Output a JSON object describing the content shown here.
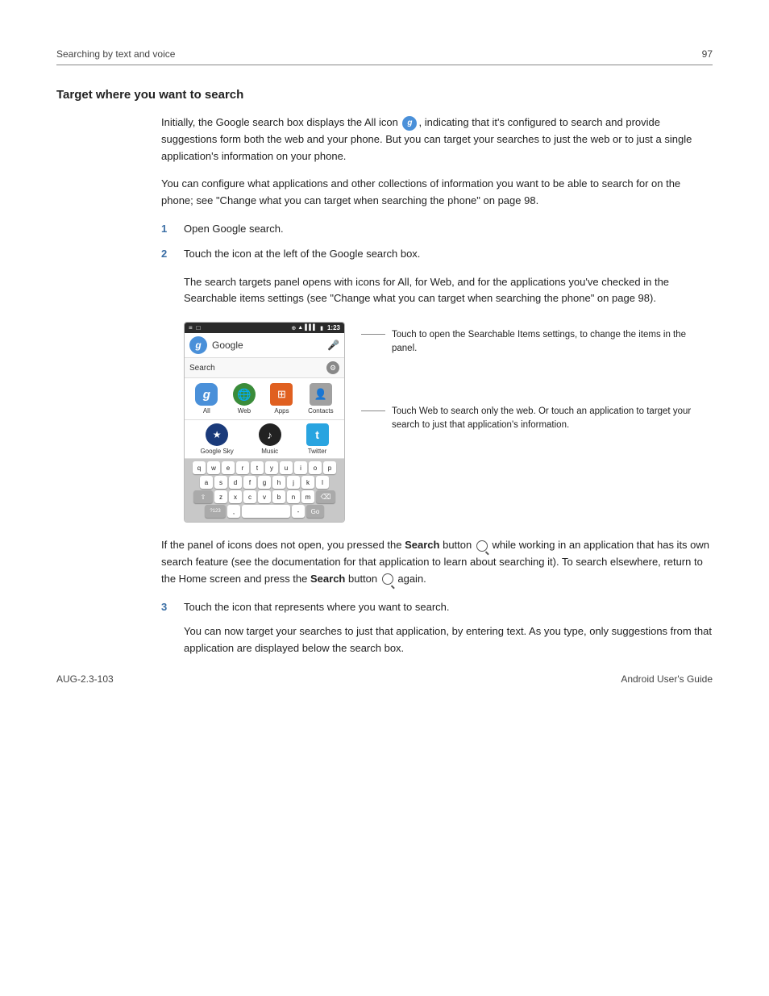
{
  "header": {
    "left": "Searching by text and voice",
    "right": "97"
  },
  "section": {
    "title": "Target where you want to search"
  },
  "paragraphs": {
    "p1": "Initially, the Google search box displays the All icon      , indicating that it's configured to search and provide suggestions form both the web and your phone. But you can target your searches to just the web or to just a single application's information on your phone.",
    "p2": "You can configure what applications and other collections of information you want to be able to search for on the phone; see \"Change what you can target when searching the phone\" on page 98.",
    "step1_label": "1",
    "step1_text": "Open Google search.",
    "step2_label": "2",
    "step2_text": "Touch the icon at the left of the Google search box.",
    "step2_sub": "The search targets panel opens with icons for All, for Web, and for the applications you've checked in the Searchable items settings (see \"Change what you can target when searching the phone\" on page 98).",
    "callout1": "Touch to open the Searchable Items settings, to change the items in the panel.",
    "callout2": "Touch Web to search only the web. Or touch an application to target your search to just that application's information.",
    "notice_part1": "If the panel of icons does not open, you pressed the ",
    "notice_bold1": "Search",
    "notice_part2": " button      while working in an application that has its own search feature (see the documentation for that application to learn about searching it). To search elsewhere, return to the Home screen and press the ",
    "notice_bold2": "Search",
    "notice_part3": " button      again.",
    "step3_label": "3",
    "step3_text": "Touch the icon that represents where you want to search.",
    "step3_sub": "You can now target your searches to just that application, by entering text. As you type, only suggestions from that application are displayed below the search box."
  },
  "phone_ui": {
    "status_time": "1:23",
    "search_placeholder": "Google",
    "search_label": "Search",
    "targets": [
      {
        "label": "All",
        "icon": "g"
      },
      {
        "label": "Web",
        "icon": "🌐"
      },
      {
        "label": "Apps",
        "icon": "⊞"
      },
      {
        "label": "Contacts",
        "icon": "👤"
      }
    ],
    "apps": [
      {
        "label": "Google Sky",
        "icon": "★"
      },
      {
        "label": "Music",
        "icon": "♪"
      },
      {
        "label": "Twitter",
        "icon": "t"
      }
    ],
    "keyboard_rows": [
      [
        "q",
        "w",
        "e",
        "r",
        "t",
        "y",
        "u",
        "i",
        "o",
        "p"
      ],
      [
        "a",
        "s",
        "d",
        "f",
        "g",
        "h",
        "j",
        "k",
        "l"
      ],
      [
        "⇧",
        "z",
        "x",
        "c",
        "v",
        "b",
        "n",
        "m",
        "⌫"
      ],
      [
        "?123",
        ",",
        "",
        "",
        "",
        "",
        "",
        "-",
        "Go"
      ]
    ]
  },
  "footer": {
    "left": "AUG-2.3-103",
    "right": "Android User's Guide"
  }
}
